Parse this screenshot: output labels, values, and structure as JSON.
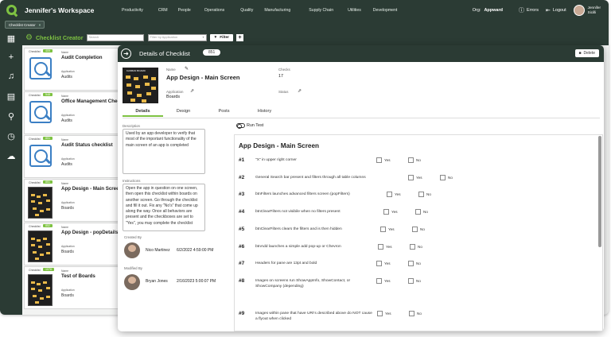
{
  "topbar": {
    "workspace": "Jennifer's Workspace",
    "nav": [
      "Productivity",
      "CRM",
      "People",
      "Operations",
      "Quality",
      "Manufacturing",
      "Supply Chain",
      "Utilities",
      "Development"
    ],
    "org_label": "Org:",
    "org_value": "Appward",
    "errors": "Errors",
    "logout": "Logout",
    "user_first": "Jennifer",
    "user_last": "Sicilli"
  },
  "open_tab": {
    "label": "Checklist Creator",
    "close": "×"
  },
  "toolbar": {
    "title": "Checklist Creator",
    "search_placeholder": "Search",
    "filter_placeholder": "Filter by Application",
    "filter_button": "Filter",
    "add_button": "+"
  },
  "list": {
    "checklist_label": "Checklist",
    "name_label": "Name",
    "application_label": "Application",
    "cards": [
      {
        "id": "409",
        "name": "Audit Completion",
        "app": "Audits",
        "thumb": "check"
      },
      {
        "id": "548",
        "name": "Office Management Checklist",
        "app": "Audits",
        "thumb": "check"
      },
      {
        "id": "801",
        "name": "Audit Status checklist",
        "app": "Audits",
        "thumb": "check"
      },
      {
        "id": "851",
        "name": "App Design - Main Screen",
        "app": "Boards",
        "thumb": "board"
      },
      {
        "id": "852",
        "name": "App Design - popDetails",
        "app": "Boards",
        "thumb": "board"
      },
      {
        "id": "1078",
        "name": "Test of Boards",
        "app": "Boards",
        "thumb": "board"
      }
    ]
  },
  "detail": {
    "header_title": "Details of Checklist",
    "header_id": "851",
    "delete": "Delete",
    "thumb_caption": "KANBAN BOARD",
    "name_label": "Name",
    "name_value": "App Design - Main Screen",
    "application_label": "Application",
    "application_value": "Boards",
    "checks_label": "Checks",
    "checks_value": "17",
    "status_label": "Status",
    "tabs": [
      "Details",
      "Design",
      "Posts",
      "History"
    ],
    "description_label": "Description",
    "description": "Used by an app developer to verify that most of the important functionality of the main screen of an app is completed",
    "instructions_label": "Instructions",
    "instructions": "Open the app in question on one screen, then open this checklist within boards on another screen. Go through the checklist and fill it out. Fix any \"No's\" that come up along the way. Once all behaviors are present and the checkboxes are set to \"Yes\", you may complete the checklist",
    "created_label": "Created By",
    "created_name": "Nico Martinez",
    "created_date": "6/2/2022 4:59:00 PM",
    "modified_label": "Modified By",
    "modified_name": "Bryan Jones",
    "modified_date": "2/16/2023 5:00:07 PM",
    "run_test": "Run Test",
    "checklist_title": "App Design - Main Screen",
    "yes": "Yes",
    "no": "No",
    "items": [
      {
        "num": "#1",
        "text": "\"X\" in upper right corner"
      },
      {
        "num": "#2",
        "text": "General Search bar present and filters through all table columns"
      },
      {
        "num": "#3",
        "text": "btnFilters launches advanced filters screen (popFilters)"
      },
      {
        "num": "#4",
        "text": "btnClearFilters not visibile when no filters present"
      },
      {
        "num": "#5",
        "text": "btnClearFilters clears the filters and is then hidden"
      },
      {
        "num": "#6",
        "text": "btnAdd launches a simple add pop-up or Chevron"
      },
      {
        "num": "#7",
        "text": "Headers for pane are 13pt and bold"
      },
      {
        "num": "#8",
        "text": "Images on screens run ShowAppInfo, ShowContact, or ShowCompany (depending)"
      },
      {
        "num": "#9",
        "text": "Images within pane that have URI's described above do NOT cause a flyout when clicked"
      }
    ]
  },
  "colors": {
    "accent": "#7ec242",
    "header": "#2b3b34"
  }
}
